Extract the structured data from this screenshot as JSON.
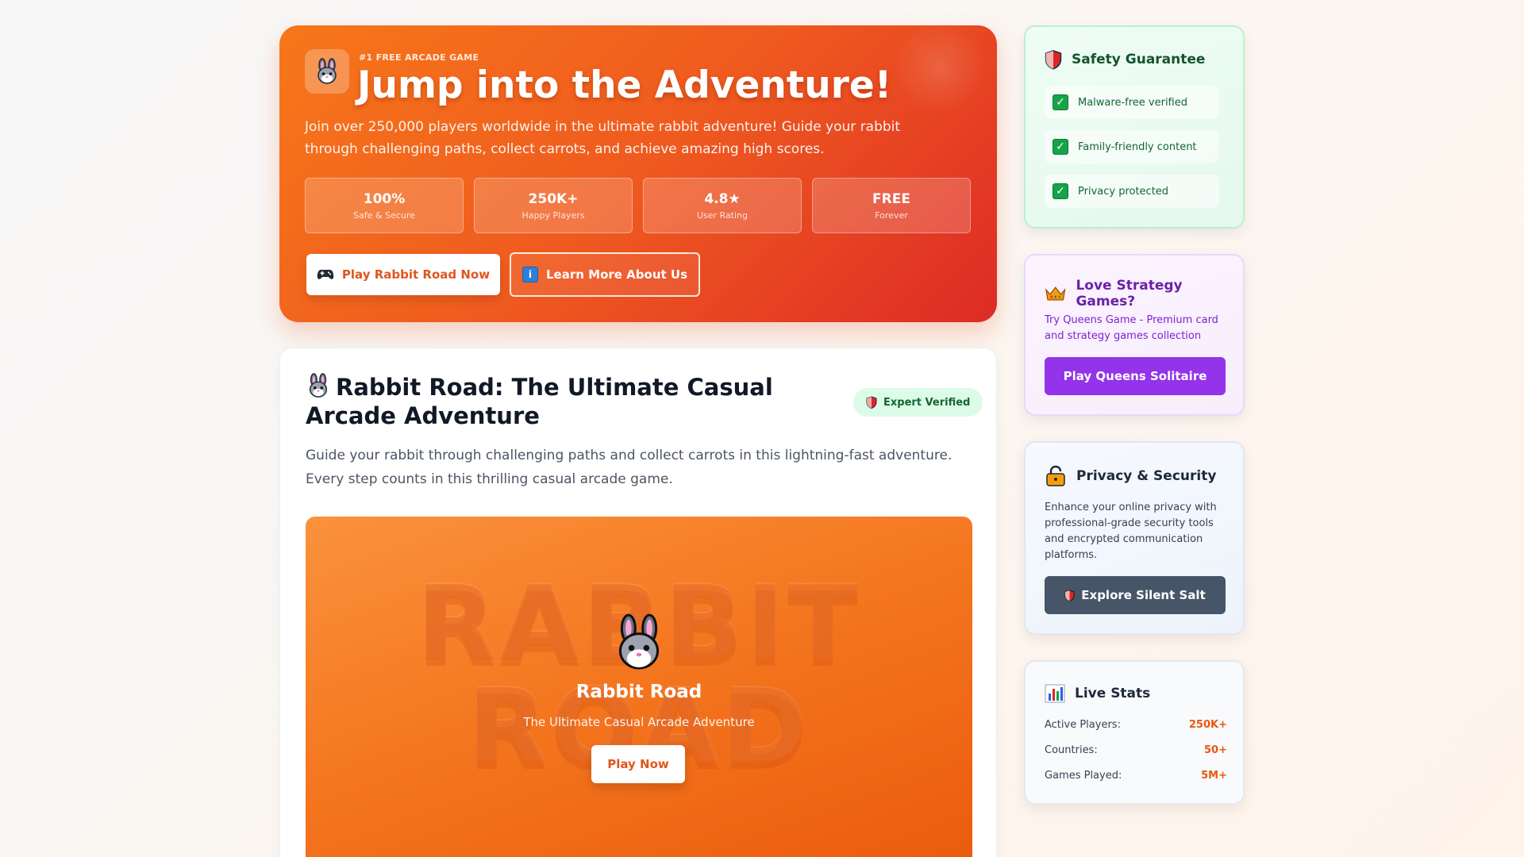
{
  "hero": {
    "kicker": "#1 FREE ARCADE GAME",
    "title": "Jump into the Adventure!",
    "description": "Join over 250,000 players worldwide in the ultimate rabbit adventure! Guide your rabbit through challenging paths, collect carrots, and achieve amazing high scores.",
    "icon": "rabbit-icon",
    "stats": [
      {
        "value": "100%",
        "label": "Safe & Secure"
      },
      {
        "value": "250K+",
        "label": "Happy Players"
      },
      {
        "value": "4.8★",
        "label": "User Rating"
      },
      {
        "value": "FREE",
        "label": "Forever"
      }
    ],
    "play_button": "Play Rabbit Road Now",
    "learn_button": "Learn More About Us",
    "info_glyph": "i"
  },
  "main": {
    "title": "Rabbit Road: The Ultimate Casual Arcade Adventure",
    "badge": "Expert Verified",
    "description": "Guide your rabbit through challenging paths and collect carrots in this lightning-fast adventure. Every step counts in this thrilling casual arcade game.",
    "game": {
      "watermark_line1": "RABBIT",
      "watermark_line2": "ROAD",
      "title": "Rabbit Road",
      "subtitle": "The Ultimate Casual Arcade Adventure",
      "play_button": "Play Now"
    }
  },
  "sidebar": {
    "safety": {
      "title": "Safety Guarantee",
      "items": [
        "Malware-free verified",
        "Family-friendly content",
        "Privacy protected"
      ],
      "check": "✓"
    },
    "queens": {
      "title": "Love Strategy Games?",
      "text": "Try Queens Game - Premium card and strategy games collection",
      "button": "Play Queens Solitaire"
    },
    "privacy": {
      "title": "Privacy & Security",
      "text": "Enhance your online privacy with professional-grade security tools and encrypted communication platforms.",
      "button": "Explore Silent Salt"
    },
    "live": {
      "title": "Live Stats",
      "rows": [
        {
          "label": "Active Players:",
          "value": "250K+"
        },
        {
          "label": "Countries:",
          "value": "50+"
        },
        {
          "label": "Games Played:",
          "value": "5M+"
        }
      ]
    }
  },
  "colors": {
    "hero_start": "#f7771a",
    "hero_end": "#dd2b26",
    "accent": "#ea580c",
    "queens_purple": "#9333ea",
    "silent_slate": "#475569",
    "safety_green": "#16a34a"
  }
}
